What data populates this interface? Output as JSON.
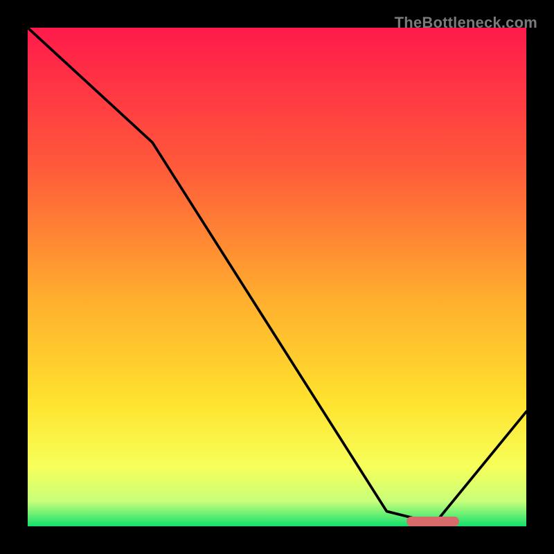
{
  "watermark": "TheBottleneck.com",
  "chart_data": {
    "type": "line",
    "title": "",
    "xlabel": "",
    "ylabel": "",
    "xlim": [
      0,
      100
    ],
    "ylim": [
      0,
      100
    ],
    "series": [
      {
        "name": "bottleneck-curve",
        "x": [
          0,
          25,
          72,
          80,
          82,
          100
        ],
        "y": [
          100,
          77,
          3,
          1,
          1,
          23
        ]
      }
    ],
    "annotations": [
      {
        "name": "optimal-marker",
        "x_start": 72,
        "x_end": 82,
        "y": 0.5,
        "color": "#d96a6c"
      }
    ],
    "background_gradient_stops": [
      {
        "offset": 0.0,
        "color": "#ff1a4b"
      },
      {
        "offset": 0.28,
        "color": "#ff5a3a"
      },
      {
        "offset": 0.55,
        "color": "#ffb02e"
      },
      {
        "offset": 0.75,
        "color": "#ffe22e"
      },
      {
        "offset": 0.88,
        "color": "#f7ff5a"
      },
      {
        "offset": 0.95,
        "color": "#c8ff7a"
      },
      {
        "offset": 1.0,
        "color": "#13e06e"
      }
    ]
  }
}
